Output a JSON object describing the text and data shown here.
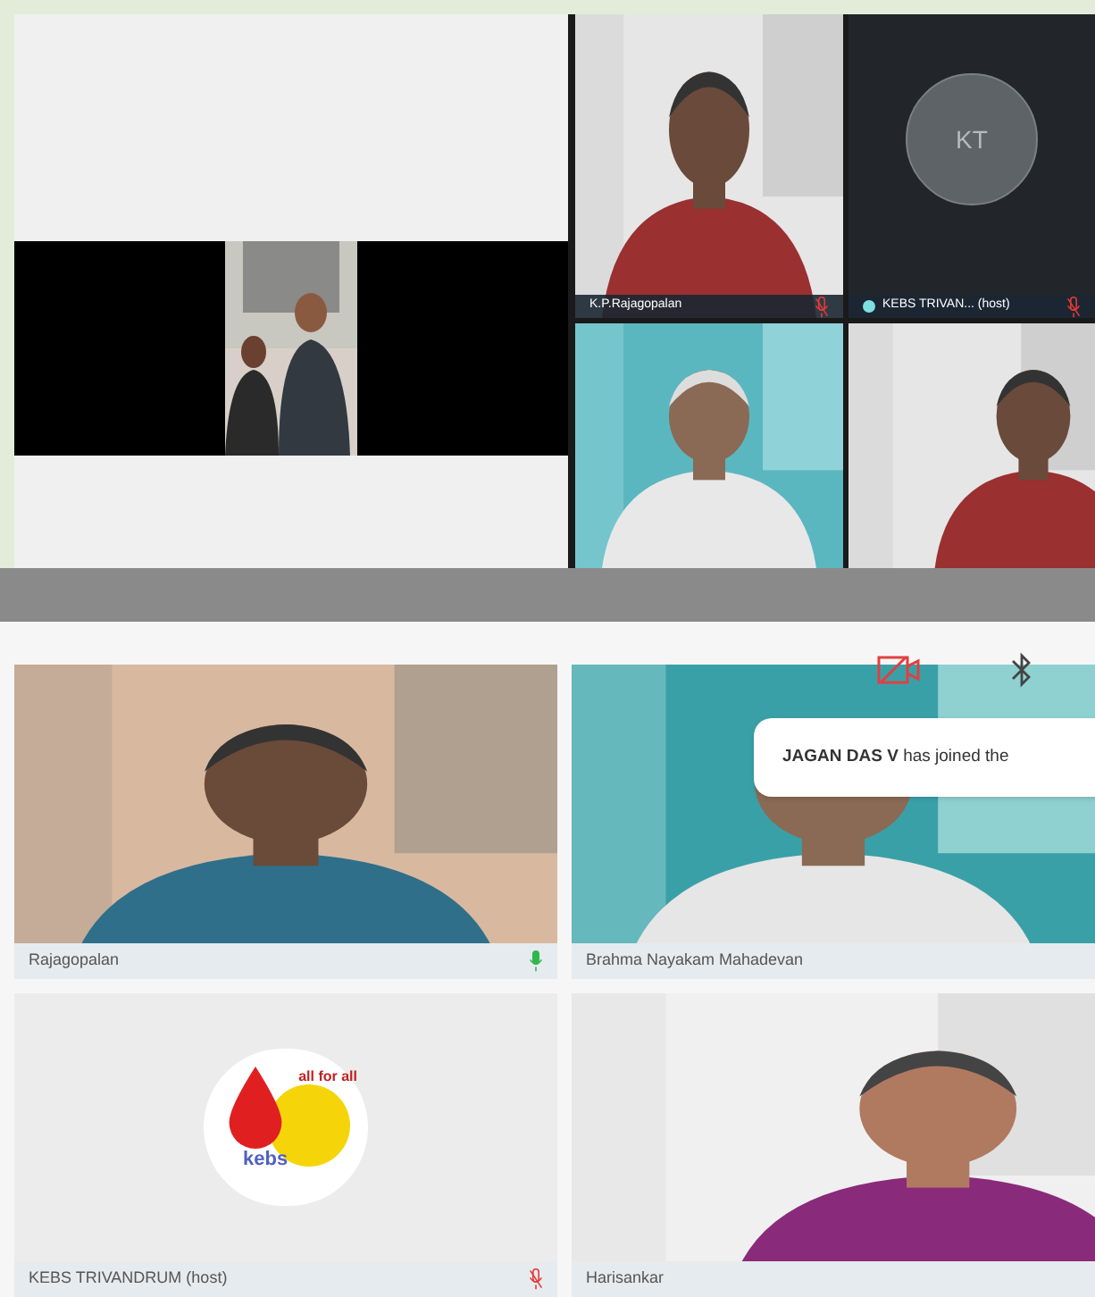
{
  "top_view": {
    "tiles": [
      {
        "kind": "video",
        "name": "K.P.Rajagopalan",
        "mic_muted": true
      },
      {
        "kind": "avatar",
        "initials": "KT",
        "name": "KEBS TRIVAN... (host)",
        "mic_muted": true
      },
      {
        "kind": "video"
      },
      {
        "kind": "video"
      }
    ]
  },
  "notification": {
    "text": "**JAGAN DAS V** has joined the"
  },
  "bottom_grid": {
    "tiles": [
      {
        "kind": "video",
        "name": "Rajagopalan",
        "mic_muted": false
      },
      {
        "kind": "video",
        "name": "Brahma Nayakam Mahadevan"
      },
      {
        "kind": "logo",
        "logo_text": "all for all",
        "logo_brand": "kebs",
        "name": "KEBS TRIVANDRUM (host)",
        "mic_muted": true
      },
      {
        "kind": "video",
        "name": "Harisankar"
      }
    ]
  }
}
